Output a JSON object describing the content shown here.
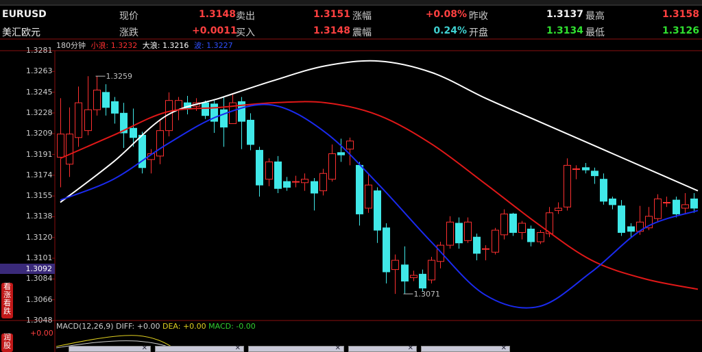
{
  "quote": {
    "symbol": "EURUSD",
    "name": "美汇欧元",
    "row1": [
      {
        "label": "现价",
        "value": "1.3148",
        "color": "#ff4040"
      },
      {
        "label": "卖出",
        "value": "1.3151",
        "color": "#ff4040"
      },
      {
        "label": "涨幅",
        "value": "+0.08%",
        "color": "#ff4040"
      },
      {
        "label": "昨收",
        "value": "1.3137",
        "color": "#f0f0f0"
      },
      {
        "label": "最高",
        "value": "1.3158",
        "color": "#ff4040"
      }
    ],
    "row2": [
      {
        "label": "涨跌",
        "value": "+0.0011",
        "color": "#ff4040"
      },
      {
        "label": "买入",
        "value": "1.3148",
        "color": "#ff4040"
      },
      {
        "label": "震幅",
        "value": "0.24%",
        "color": "#3fd0d0"
      },
      {
        "label": "开盘",
        "value": "1.3134",
        "color": "#30e030"
      },
      {
        "label": "最低",
        "value": "1.3126",
        "color": "#30e030"
      }
    ]
  },
  "chart_info": {
    "period": "180分钟",
    "small_wave_label": "小浪:",
    "small_wave_value": "1.3232",
    "big_wave_label": "大浪:",
    "big_wave_value": "1.3216",
    "wave_label": "波:",
    "wave_value": "1.3227"
  },
  "current_price_tag": "1.3092",
  "annotations": {
    "high": "1.3259",
    "low": "1.3071"
  },
  "macd": {
    "label": "MACD(12,26,9)",
    "diff": "DIFF: +0.00",
    "dea": "DEA: +0.00",
    "macd": "MACD: -0.00",
    "zero": "+0.00"
  },
  "side_tabs": [
    "看涨看跌",
    "润股"
  ],
  "chart_data": {
    "type": "candlestick",
    "ylim": [
      1.3048,
      1.3281
    ],
    "yticks": [
      "1.3281",
      "1.3263",
      "1.3245",
      "1.3228",
      "1.3209",
      "1.3191",
      "1.3174",
      "1.3155",
      "1.3138",
      "1.3120",
      "1.3101",
      "1.3084",
      "1.3066",
      "1.3048"
    ],
    "candles": [
      {
        "o": 1.3189,
        "c": 1.3209,
        "h": 1.324,
        "l": 1.3163
      },
      {
        "o": 1.3183,
        "c": 1.3209,
        "h": 1.3232,
        "l": 1.3172
      },
      {
        "o": 1.3206,
        "c": 1.3236,
        "h": 1.325,
        "l": 1.3198
      },
      {
        "o": 1.3212,
        "c": 1.323,
        "h": 1.3259,
        "l": 1.3208
      },
      {
        "o": 1.323,
        "c": 1.3247,
        "h": 1.3259,
        "l": 1.3225
      },
      {
        "o": 1.3245,
        "c": 1.3232,
        "h": 1.3252,
        "l": 1.3225
      },
      {
        "o": 1.3237,
        "c": 1.3227,
        "h": 1.3241,
        "l": 1.3218
      },
      {
        "o": 1.3227,
        "c": 1.321,
        "h": 1.3236,
        "l": 1.3197
      },
      {
        "o": 1.3214,
        "c": 1.3206,
        "h": 1.3231,
        "l": 1.3198
      },
      {
        "o": 1.3208,
        "c": 1.318,
        "h": 1.3211,
        "l": 1.3175
      },
      {
        "o": 1.3187,
        "c": 1.3192,
        "h": 1.3196,
        "l": 1.3175
      },
      {
        "o": 1.319,
        "c": 1.3212,
        "h": 1.3221,
        "l": 1.3183
      },
      {
        "o": 1.3212,
        "c": 1.3238,
        "h": 1.3245,
        "l": 1.3207
      },
      {
        "o": 1.323,
        "c": 1.3238,
        "h": 1.3241,
        "l": 1.3221
      },
      {
        "o": 1.3236,
        "c": 1.3231,
        "h": 1.3242,
        "l": 1.3226
      },
      {
        "o": 1.3233,
        "c": 1.3236,
        "h": 1.324,
        "l": 1.3229
      },
      {
        "o": 1.3236,
        "c": 1.3225,
        "h": 1.3238,
        "l": 1.3222
      },
      {
        "o": 1.3235,
        "c": 1.322,
        "h": 1.3239,
        "l": 1.321
      },
      {
        "o": 1.323,
        "c": 1.3215,
        "h": 1.3241,
        "l": 1.3198
      },
      {
        "o": 1.3218,
        "c": 1.3236,
        "h": 1.3243,
        "l": 1.3218
      },
      {
        "o": 1.3237,
        "c": 1.322,
        "h": 1.3241,
        "l": 1.3196
      },
      {
        "o": 1.3221,
        "c": 1.32,
        "h": 1.3227,
        "l": 1.3195
      },
      {
        "o": 1.3195,
        "c": 1.3165,
        "h": 1.3198,
        "l": 1.3155
      },
      {
        "o": 1.317,
        "c": 1.3185,
        "h": 1.3188,
        "l": 1.3164
      },
      {
        "o": 1.3185,
        "c": 1.3162,
        "h": 1.319,
        "l": 1.3158
      },
      {
        "o": 1.3168,
        "c": 1.3163,
        "h": 1.3172,
        "l": 1.316
      },
      {
        "o": 1.3168,
        "c": 1.3168,
        "h": 1.3173,
        "l": 1.3163
      },
      {
        "o": 1.3167,
        "c": 1.317,
        "h": 1.3175,
        "l": 1.316
      },
      {
        "o": 1.3168,
        "c": 1.3158,
        "h": 1.3171,
        "l": 1.3143
      },
      {
        "o": 1.316,
        "c": 1.3175,
        "h": 1.3179,
        "l": 1.3156
      },
      {
        "o": 1.317,
        "c": 1.3192,
        "h": 1.32,
        "l": 1.3168
      },
      {
        "o": 1.3193,
        "c": 1.3191,
        "h": 1.3205,
        "l": 1.3185
      },
      {
        "o": 1.3196,
        "c": 1.3203,
        "h": 1.3206,
        "l": 1.3182
      },
      {
        "o": 1.3182,
        "c": 1.314,
        "h": 1.3185,
        "l": 1.313
      },
      {
        "o": 1.3145,
        "c": 1.3165,
        "h": 1.3175,
        "l": 1.3141
      },
      {
        "o": 1.316,
        "c": 1.3126,
        "h": 1.3163,
        "l": 1.3115
      },
      {
        "o": 1.3128,
        "c": 1.309,
        "h": 1.3132,
        "l": 1.308
      },
      {
        "o": 1.3092,
        "c": 1.31,
        "h": 1.3105,
        "l": 1.3071
      },
      {
        "o": 1.3096,
        "c": 1.3082,
        "h": 1.3112,
        "l": 1.3071
      },
      {
        "o": 1.3085,
        "c": 1.3087,
        "h": 1.3091,
        "l": 1.3082
      },
      {
        "o": 1.3088,
        "c": 1.3076,
        "h": 1.3092,
        "l": 1.3073
      },
      {
        "o": 1.3083,
        "c": 1.31,
        "h": 1.3103,
        "l": 1.308
      },
      {
        "o": 1.3099,
        "c": 1.3113,
        "h": 1.3116,
        "l": 1.3093
      },
      {
        "o": 1.3113,
        "c": 1.3133,
        "h": 1.3138,
        "l": 1.311
      },
      {
        "o": 1.3132,
        "c": 1.3115,
        "h": 1.3137,
        "l": 1.311
      },
      {
        "o": 1.3117,
        "c": 1.3133,
        "h": 1.3137,
        "l": 1.3115
      },
      {
        "o": 1.312,
        "c": 1.3106,
        "h": 1.3123,
        "l": 1.31
      },
      {
        "o": 1.311,
        "c": 1.311,
        "h": 1.3113,
        "l": 1.31
      },
      {
        "o": 1.3107,
        "c": 1.3126,
        "h": 1.3128,
        "l": 1.3105
      },
      {
        "o": 1.3122,
        "c": 1.314,
        "h": 1.3144,
        "l": 1.3118
      },
      {
        "o": 1.314,
        "c": 1.3124,
        "h": 1.3141,
        "l": 1.3121
      },
      {
        "o": 1.3124,
        "c": 1.3132,
        "h": 1.3134,
        "l": 1.3118
      },
      {
        "o": 1.3127,
        "c": 1.3116,
        "h": 1.313,
        "l": 1.3112
      },
      {
        "o": 1.3116,
        "c": 1.3124,
        "h": 1.3126,
        "l": 1.3114
      },
      {
        "o": 1.3123,
        "c": 1.3141,
        "h": 1.3146,
        "l": 1.312
      },
      {
        "o": 1.3143,
        "c": 1.3145,
        "h": 1.315,
        "l": 1.314
      },
      {
        "o": 1.3146,
        "c": 1.3182,
        "h": 1.3188,
        "l": 1.3143
      },
      {
        "o": 1.3179,
        "c": 1.3179,
        "h": 1.3182,
        "l": 1.317
      },
      {
        "o": 1.318,
        "c": 1.3178,
        "h": 1.3184,
        "l": 1.3175
      },
      {
        "o": 1.3177,
        "c": 1.3173,
        "h": 1.318,
        "l": 1.3166
      },
      {
        "o": 1.317,
        "c": 1.3151,
        "h": 1.3175,
        "l": 1.3148
      },
      {
        "o": 1.3153,
        "c": 1.3148,
        "h": 1.3155,
        "l": 1.3144
      },
      {
        "o": 1.3147,
        "c": 1.3124,
        "h": 1.3152,
        "l": 1.3121
      },
      {
        "o": 1.3129,
        "c": 1.3125,
        "h": 1.3132,
        "l": 1.3119
      },
      {
        "o": 1.3125,
        "c": 1.3133,
        "h": 1.3147,
        "l": 1.3122
      },
      {
        "o": 1.3128,
        "c": 1.3138,
        "h": 1.3146,
        "l": 1.3126
      },
      {
        "o": 1.3136,
        "c": 1.3153,
        "h": 1.3157,
        "l": 1.3133
      },
      {
        "o": 1.315,
        "c": 1.315,
        "h": 1.3155,
        "l": 1.3146
      },
      {
        "o": 1.3152,
        "c": 1.314,
        "h": 1.3155,
        "l": 1.3137
      },
      {
        "o": 1.3145,
        "c": 1.3148,
        "h": 1.3158,
        "l": 1.314
      },
      {
        "o": 1.3153,
        "c": 1.3145,
        "h": 1.3158,
        "l": 1.3141
      }
    ],
    "series": [
      {
        "color": "#ffffff",
        "values": [
          1.315,
          1.3185,
          1.3225,
          1.324,
          1.3255,
          1.3268,
          1.3272,
          1.3262,
          1.324,
          1.322,
          1.32,
          1.318,
          1.316
        ]
      },
      {
        "color": "#e01818",
        "values": [
          1.3188,
          1.3208,
          1.3228,
          1.3232,
          1.3236,
          1.3236,
          1.3225,
          1.32,
          1.3166,
          1.3131,
          1.31,
          1.3084,
          1.3075
        ]
      },
      {
        "color": "#1a2aee",
        "values": [
          1.3152,
          1.317,
          1.32,
          1.3225,
          1.3234,
          1.321,
          1.3165,
          1.3115,
          1.307,
          1.306,
          1.309,
          1.3128,
          1.3143
        ]
      }
    ]
  }
}
